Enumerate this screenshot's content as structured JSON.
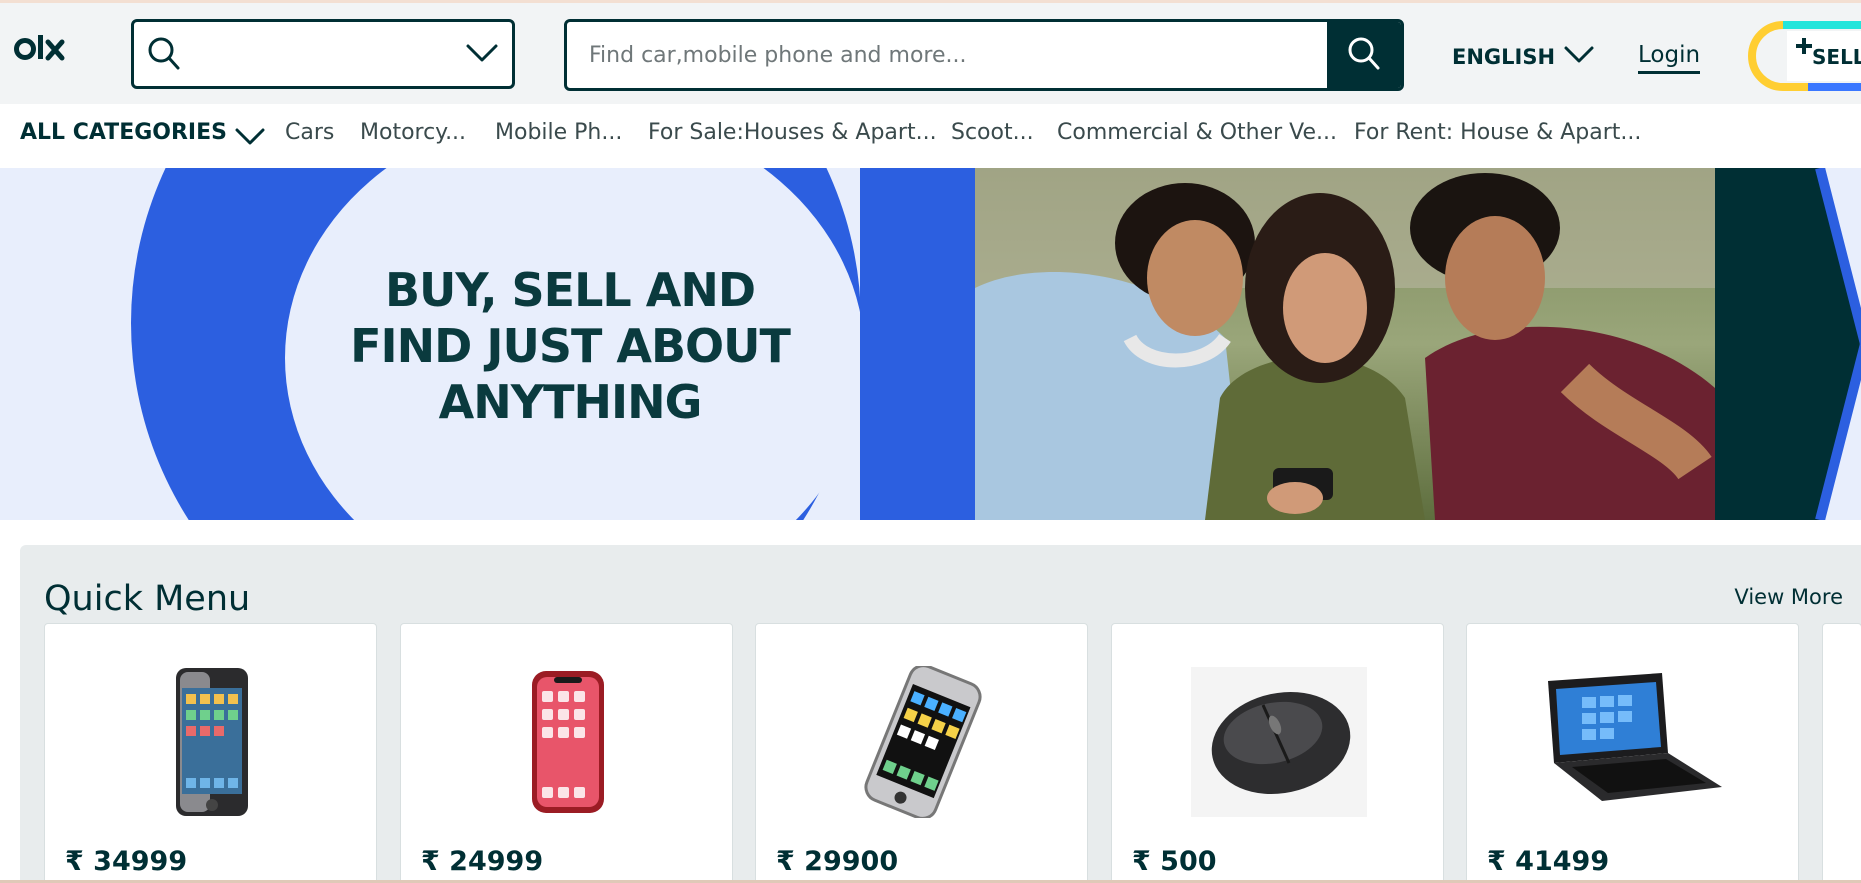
{
  "header": {
    "logo_text": "olx",
    "location_placeholder": "",
    "search_placeholder": "Find car,mobile phone and more...",
    "language": "ENGLISH",
    "login_label": "Login",
    "sell_label": "SELL"
  },
  "categories": {
    "all_label": "ALL CATEGORIES",
    "items": [
      "Cars",
      "Motorcy...",
      "Mobile Ph...",
      "For Sale:Houses & Apart...",
      "Scoot...",
      "Commercial & Other Ve...",
      "For Rent: House & Apart..."
    ]
  },
  "banner": {
    "headline_line1": "BUY, SELL AND",
    "headline_line2": "FIND JUST ABOUT",
    "headline_line3": "ANYTHING"
  },
  "quick_menu": {
    "title": "Quick Menu",
    "view_more": "View More",
    "items": [
      {
        "price": "₹ 34999",
        "icon": "smartphone-silver"
      },
      {
        "price": "₹ 24999",
        "icon": "smartphone-red"
      },
      {
        "price": "₹ 29900",
        "icon": "smartphone-classic"
      },
      {
        "price": "₹ 500",
        "icon": "computer-mouse"
      },
      {
        "price": "₹ 41499",
        "icon": "laptop"
      }
    ]
  },
  "colors": {
    "brand_dark": "#002f34",
    "brand_blue": "#2c5fe0",
    "sell_yellow": "#ffce32",
    "sell_teal": "#23e5db",
    "sell_blue": "#3a77ff"
  }
}
